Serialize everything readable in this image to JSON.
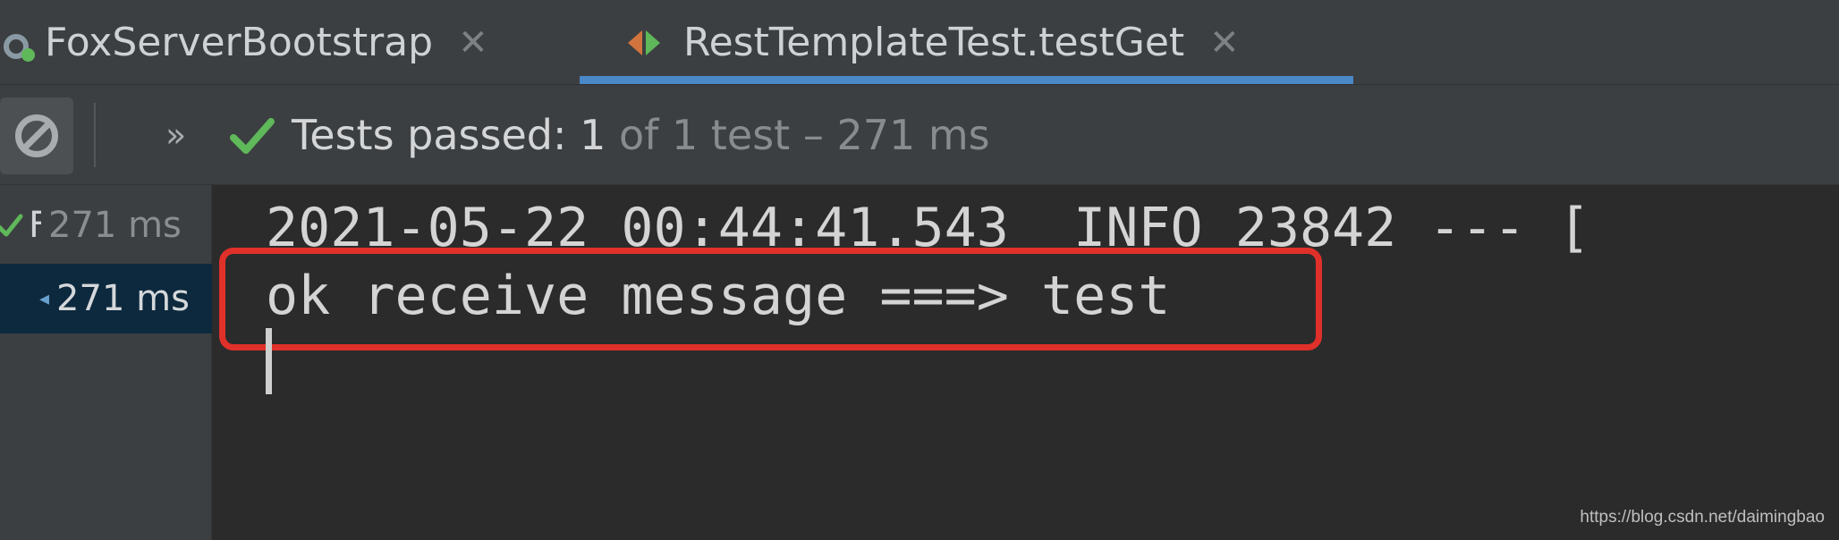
{
  "tabs": [
    {
      "label": "FoxServerBootstrap",
      "icon": "spring-bootstrap-icon",
      "active": false
    },
    {
      "label": "RestTemplateTest.testGet",
      "icon": "test-run-icon",
      "active": true
    }
  ],
  "toolbar": {
    "stop_icon": "stop-icon",
    "more_label": "»",
    "status_main": "Tests passed: 1",
    "status_detail": " of 1 test – 271 ms"
  },
  "tree": {
    "rows": [
      {
        "label": "F",
        "time": "271 ms",
        "status": "passed"
      },
      {
        "time": "271 ms",
        "selected": true
      }
    ]
  },
  "console": {
    "lines": [
      "2021-05-22 00:44:41.543  INFO 23842 --- [",
      "ok receive message ===> test"
    ]
  },
  "watermark": "https://blog.csdn.net/daimingbao",
  "colors": {
    "accent": "#4a88c7",
    "success": "#5fb85a",
    "highlight": "#e0302a"
  }
}
